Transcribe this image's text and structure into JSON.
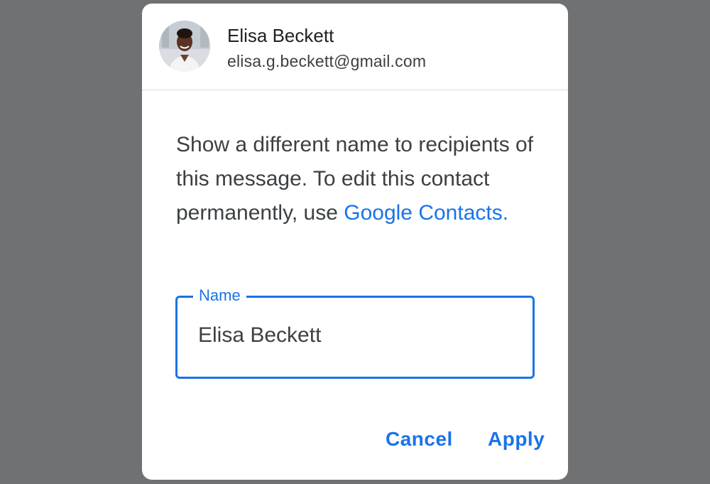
{
  "account": {
    "name": "Elisa Beckett",
    "email": "elisa.g.beckett@gmail.com",
    "avatar_icon": "profile-photo"
  },
  "message": {
    "text": "Show a different name to recipients of this message. To edit this contact permanently, use ",
    "link_label": "Google Contacts."
  },
  "name_field": {
    "label": "Name",
    "value": "Elisa Beckett"
  },
  "actions": {
    "cancel_label": "Cancel",
    "apply_label": "Apply"
  },
  "colors": {
    "backdrop": "#707173",
    "accent": "#1a73e8",
    "text": "#3c4043"
  }
}
